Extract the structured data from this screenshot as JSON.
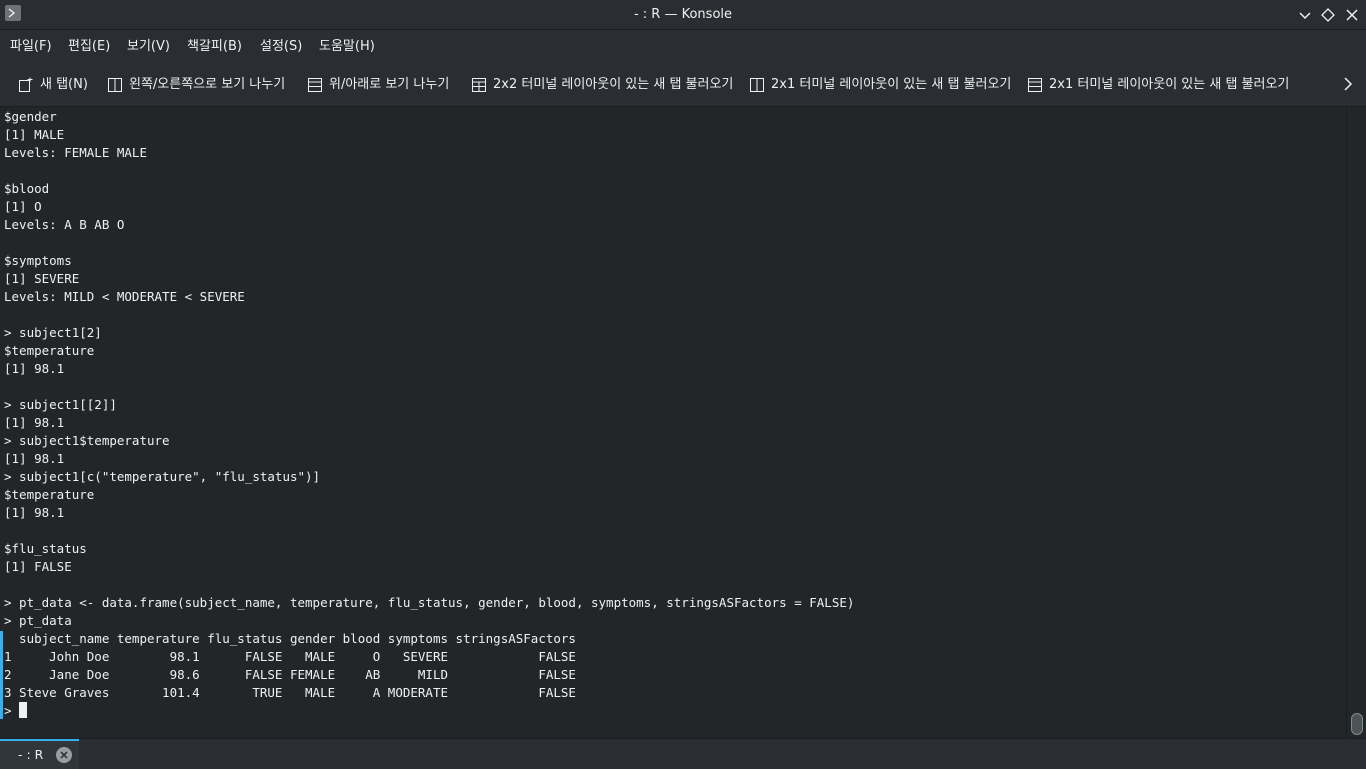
{
  "window": {
    "title": "- : R — Konsole"
  },
  "titlebar_buttons": [
    {
      "name": "minimize",
      "icon": "chevron-down-icon"
    },
    {
      "name": "maximize",
      "icon": "diamond-icon"
    },
    {
      "name": "close",
      "icon": "close-icon"
    }
  ],
  "menu": {
    "file": "파일(F)",
    "edit": "편집(E)",
    "view": "보기(V)",
    "bookmarks": "책갈피(B)",
    "settings": "설정(S)",
    "help": "도움말(H)"
  },
  "toolbar": {
    "new_tab": "새 탭(N)",
    "split_left_right": "왼쪽/오른쪽으로 보기 나누기",
    "split_top_bottom": "위/아래로 보기 나누기",
    "layout_2x2": "2x2 터미널 레이아웃이 있는 새 탭 불러오기",
    "layout_2x1_a": "2x1 터미널 레이아웃이 있는 새 탭 불러오기",
    "layout_2x1_b": "2x1 터미널 레이아웃이 있는 새 탭 불러오기",
    "more_icon": "chevron-right-icon"
  },
  "terminal": {
    "lines": [
      "$gender",
      "[1] MALE",
      "Levels: FEMALE MALE",
      "",
      "$blood",
      "[1] O",
      "Levels: A B AB O",
      "",
      "$symptoms",
      "[1] SEVERE",
      "Levels: MILD < MODERATE < SEVERE",
      "",
      "> subject1[2]",
      "$temperature",
      "[1] 98.1",
      "",
      "> subject1[[2]]",
      "[1] 98.1",
      "> subject1$temperature",
      "[1] 98.1",
      "> subject1[c(\"temperature\", \"flu_status\")]",
      "$temperature",
      "[1] 98.1",
      "",
      "$flu_status",
      "[1] FALSE",
      "",
      "> pt_data <- data.frame(subject_name, temperature, flu_status, gender, blood, symptoms, stringsASFactors = FALSE)",
      "> pt_data",
      "  subject_name temperature flu_status gender blood symptoms stringsASFactors",
      "1     John Doe        98.1      FALSE   MALE     O   SEVERE            FALSE",
      "2     Jane Doe        98.6      FALSE FEMALE    AB     MILD            FALSE",
      "3 Steve Graves       101.4       TRUE   MALE     A MODERATE            FALSE"
    ],
    "prompt": "> "
  },
  "tabs": [
    {
      "label": "- : R",
      "close_icon": "close-circle-icon"
    }
  ],
  "colors": {
    "background": "#232629",
    "chrome": "#2a2e32",
    "text": "#eff0f1",
    "accent": "#3daee9"
  }
}
